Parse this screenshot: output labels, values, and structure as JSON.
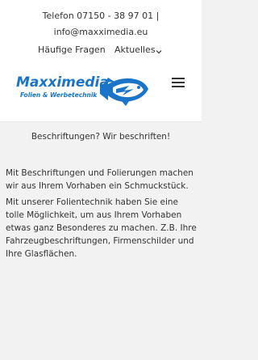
{
  "header": {
    "phone": "Telefon 07150 - 38 97 01 |",
    "email": "info@maxximedia.eu"
  },
  "nav": {
    "faq": "Häufige Fragen",
    "news": "Aktuelles"
  },
  "logo": {
    "brand": "Maxximedia",
    "tagline": "Folien & Werbetechnik",
    "brand_color": "#1a74c8"
  },
  "main": {
    "headline": "Beschriftungen? Wir beschriften!",
    "paragraph1": "Mit Beschriftungen und Folierungen machen wir aus Ihrem Vorhaben ein Schmuckstück.",
    "paragraph2": "Mit unserer Folientechnik haben Sie eine tolle Möglichkeit, um aus Ihrem Vorhaben etwas ganz Besonderes zu machen. Z.B. Ihre Fahrzeugbeschriftungen, Firmenschilder und Ihre Glasflächen."
  },
  "icons": {
    "menu": "hamburger-menu-icon",
    "dropdown": "chevron-down-icon",
    "logo": "fish-logo-icon"
  }
}
